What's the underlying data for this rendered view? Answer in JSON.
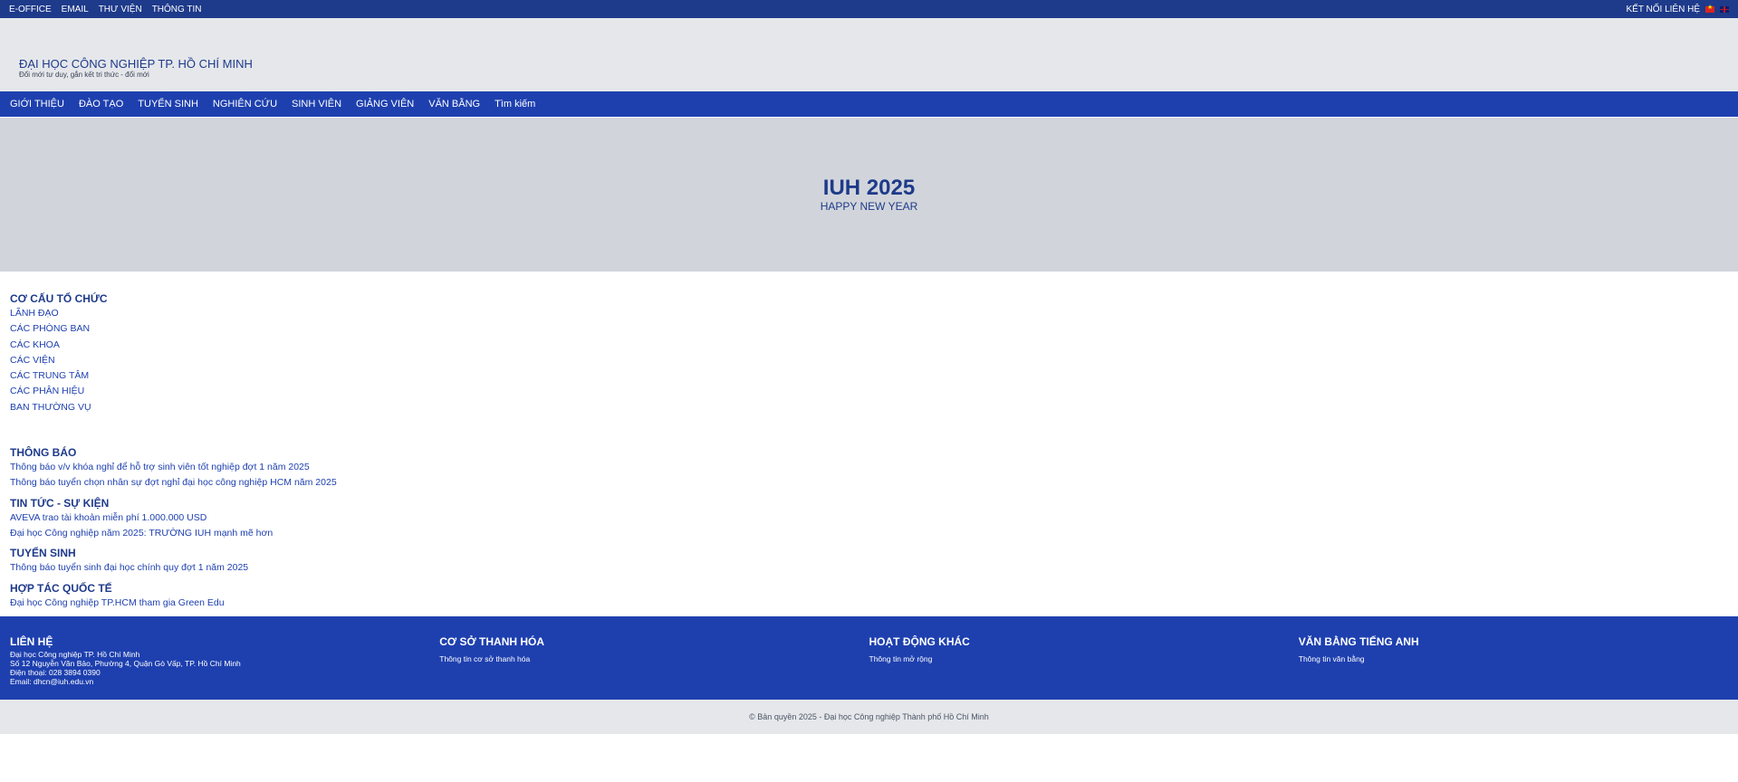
{
  "topbar": {
    "links": [
      "E-OFFICE",
      "EMAIL",
      "THƯ VIỆN",
      "THÔNG TIN"
    ],
    "contact": "KẾT NỐI LIÊN HỆ"
  },
  "header": {
    "title": "ĐẠI HỌC CÔNG NGHIỆP TP. HỒ CHÍ MINH",
    "slogan": "Đổi mới tư duy, gắn kết tri thức - đổi mới"
  },
  "nav": [
    "GIỚI THIỆU",
    "ĐÀO TẠO",
    "TUYỂN SINH",
    "NGHIÊN CỨU",
    "SINH VIÊN",
    "GIẢNG VIÊN",
    "VĂN BẰNG",
    "Tìm kiếm"
  ],
  "hero": {
    "title": "IUH 2025",
    "subtitle": "HAPPY NEW YEAR"
  },
  "org": {
    "title": "CƠ CẤU TỔ CHỨC",
    "items": [
      "LÃNH ĐẠO",
      "CÁC PHÒNG BAN",
      "CÁC KHOA",
      "CÁC VIỆN",
      "CÁC TRUNG TÂM",
      "CÁC PHÂN HIỆU",
      "BAN THƯỜNG VỤ"
    ]
  },
  "news": [
    {
      "title": "THÔNG BÁO",
      "items": [
        "Thông báo v/v khóa nghỉ để hỗ trợ sinh viên tốt nghiệp đợt 1 năm 2025",
        "Thông báo tuyển chọn nhân sự đợt nghỉ đại học công nghiệp HCM năm 2025"
      ]
    },
    {
      "title": "TIN TỨC - SỰ KIỆN",
      "items": [
        "AVEVA trao tài khoản miễn phí 1.000.000 USD",
        "Đại học Công nghiệp năm 2025: TRƯỜNG IUH mạnh mẽ hơn"
      ]
    },
    {
      "title": "TUYỂN SINH",
      "items": [
        "Thông báo tuyển sinh đại học chính quy đợt 1 năm 2025"
      ]
    },
    {
      "title": "HỢP TÁC QUỐC TẾ",
      "items": [
        "Đại học Công nghiệp TP.HCM tham gia Green Edu"
      ]
    }
  ],
  "footer": {
    "columns": [
      {
        "title": "LIÊN HỆ",
        "lines": [
          "Đại học Công nghiệp TP. Hồ Chí Minh",
          "Số 12 Nguyễn Văn Bảo, Phường 4, Quận Gò Vấp, TP. Hồ Chí Minh",
          "Điện thoại: 028 3894 0390",
          "Email: dhcn@iuh.edu.vn"
        ]
      },
      {
        "title": "CƠ SỞ THANH HÓA",
        "lines": [
          "Thông tin cơ sở thanh hóa"
        ]
      },
      {
        "title": "HOẠT ĐỘNG KHÁC",
        "lines": [
          "Thông tin mở rộng"
        ]
      },
      {
        "title": "VĂN BẰNG TIẾNG ANH",
        "lines": [
          "Thông tin văn bằng"
        ]
      }
    ],
    "copyright": "© Bản quyền 2025 - Đại học Công nghiệp Thành phố Hồ Chí Minh"
  },
  "colors": {
    "topbar": "#1e3a8a",
    "nav": "#1e40af",
    "header_bg": "#e5e7eb",
    "hero_bg": "#d1d5db"
  }
}
